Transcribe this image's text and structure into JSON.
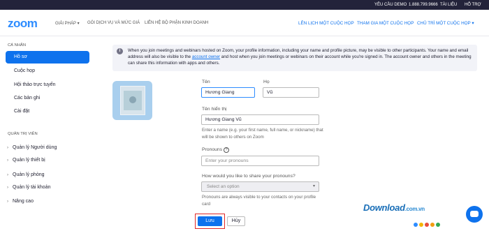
{
  "topbar": {
    "support": "YÊU CẦU DEMO",
    "phone": "1.888.799.9666",
    "resources": "TÀI LIỆU",
    "support_link": "HỖ TRỢ"
  },
  "nav": {
    "logo": "zoom",
    "left": [
      "GIẢI PHÁP ▾",
      "GÓI DỊCH VỤ VÀ MỨC GIÁ",
      "LIÊN HỆ BỘ PHẬN KINH DOANH"
    ],
    "right": [
      "LÊN LỊCH MỘT CUỘC HỌP",
      "THAM GIA MỘT CUỘC HỌP",
      "CHỦ TRÌ MỘT CUỘC HỌP ▾"
    ]
  },
  "sidebar": {
    "personal_title": "CÁ NHÂN",
    "personal_items": [
      "Hồ sơ",
      "Cuộc họp",
      "Hội thảo trực tuyến",
      "Các bản ghi",
      "Cài đặt"
    ],
    "admin_title": "QUẢN TRỊ VIÊN",
    "admin_items": [
      "Quản lý Người dùng",
      "Quản lý thiết bị",
      "Quản lý phòng",
      "Quản lý tài khoản",
      "Nâng cao"
    ]
  },
  "notice": {
    "text_before": "When you join meetings and webinars hosted on Zoom, your profile information, including your name and profile picture, may be visible to other participants. Your name and email address will also be visible to the ",
    "link": "account owner",
    "text_after": " and host when you join meetings or webinars on their account while you're signed in. The account owner and others in the meeting can share this information with apps and others."
  },
  "form": {
    "first_name_label": "Tên",
    "first_name_value": "Hương Giang",
    "last_name_label": "Họ",
    "last_name_value": "Vũ",
    "display_label": "Tên hiển thị",
    "display_value": "Hương Giang Vũ",
    "display_hint": "Enter a name (e.g. your first name, full name, or nickname) that will be shown to others on Zoom",
    "pronouns_label": "Pronouns",
    "pronouns_placeholder": "Enter your pronouns",
    "share_label": "How would you like to share your pronouns?",
    "share_select": "Select an option",
    "share_hint": "Pronouns are always visible to your contacts on your profile card",
    "save": "Lưu",
    "cancel": "Hủy"
  },
  "watermark": {
    "brand": "Download",
    "domain": ".com.vn"
  },
  "colors": {
    "accent": "#0e72ed",
    "brand": "#2d8cff",
    "highlight": "#e02828"
  }
}
